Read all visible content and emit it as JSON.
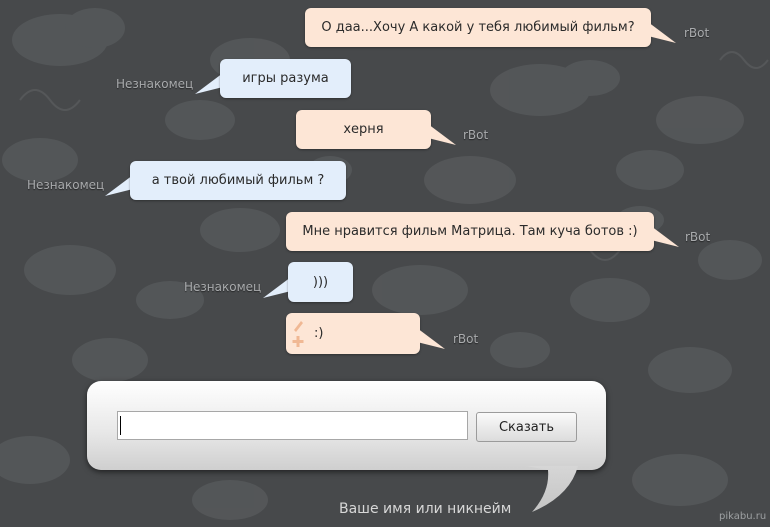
{
  "colors": {
    "background": "#47494b",
    "bot_bubble": "#fde6d6",
    "user_bubble": "#e3eefb",
    "name_text": "#a9abad"
  },
  "messages": [
    {
      "sender": "rBot",
      "text": "О даа...Хочу А какой у тебя любимый фильм?"
    },
    {
      "sender": "Незнакомец",
      "text": "игры разума"
    },
    {
      "sender": "rBot",
      "text": "херня"
    },
    {
      "sender": "Незнакомец",
      "text": "а твой любимый фильм ?"
    },
    {
      "sender": "rBot",
      "text": "Мне нравится фильм Матрица. Там куча ботов :)"
    },
    {
      "sender": "Незнакомец",
      "text": ")))"
    },
    {
      "sender": "rBot",
      "text": ":)"
    }
  ],
  "input": {
    "value": "",
    "placeholder": ""
  },
  "say_button": "Сказать",
  "name_hint": "Ваше имя или никнейм",
  "watermark": "pikabu.ru"
}
